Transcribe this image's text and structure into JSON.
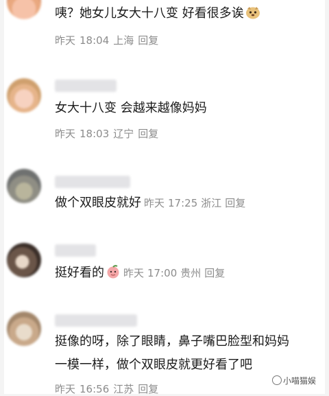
{
  "comments": [
    {
      "text": "咦？她女儿女大十八变 好看很多诶",
      "date": "昨天",
      "time": "18:04",
      "location": "上海",
      "reply": "回复",
      "emoji": "dog-face-icon"
    },
    {
      "text": "女大十八变 会越来越像妈妈",
      "date": "昨天",
      "time": "18:03",
      "location": "辽宁",
      "reply": "回复"
    },
    {
      "text": "做个双眼皮就好",
      "date": "昨天",
      "time": "17:25",
      "location": "浙江",
      "reply": "回复"
    },
    {
      "text": "挺好看的",
      "date": "昨天",
      "time": "17:00",
      "location": "贵州",
      "reply": "回复",
      "emoji": "peach-face-icon"
    },
    {
      "text_line1": "挺像的呀，除了眼睛，鼻子嘴巴脸型和妈妈",
      "text_line2": "一模一样，做个双眼皮就更好看了吧",
      "date": "昨天",
      "time": "16:56",
      "location": "江苏",
      "reply": "回复"
    }
  ],
  "watermark": "小喵猫娱",
  "colors": {
    "text": "#1b1b1b",
    "meta": "#8c8c8c",
    "background": "#ffffff"
  }
}
